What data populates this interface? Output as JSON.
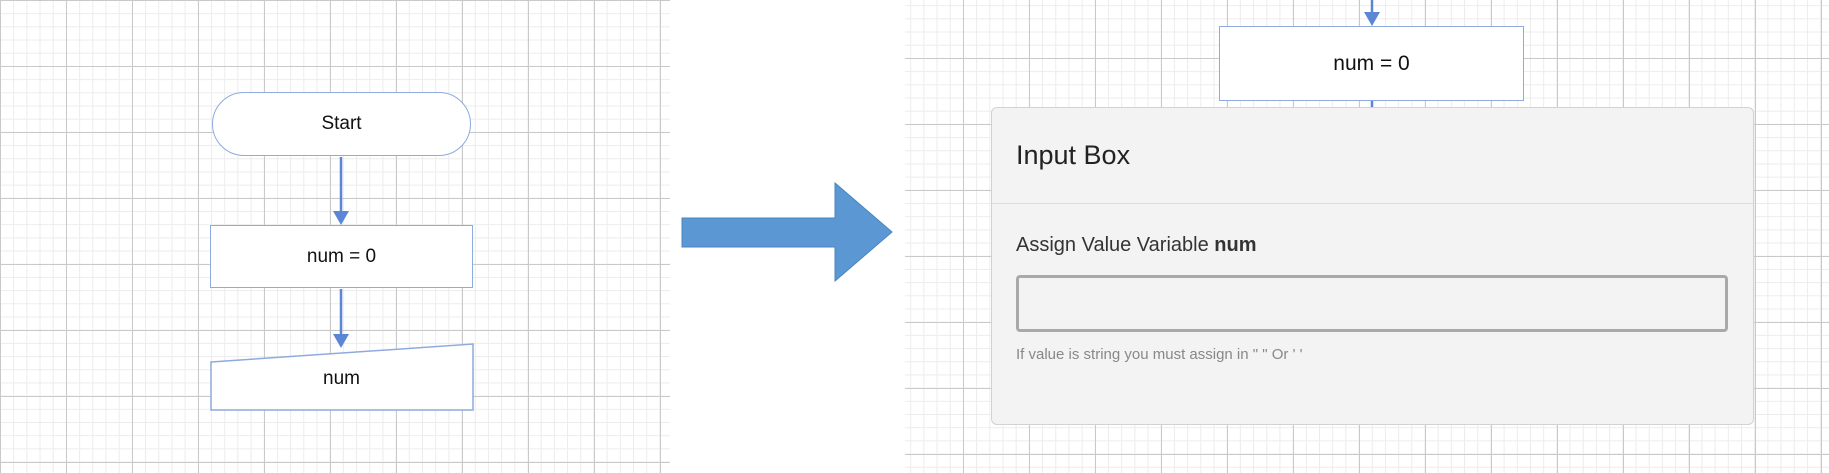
{
  "flowchart": {
    "start_label": "Start",
    "assign_label": "num = 0",
    "input_label": "num"
  },
  "zoomed": {
    "assign_label": "num = 0"
  },
  "dialog": {
    "title": "Input Box",
    "assign_prefix": "Assign Value Variable ",
    "variable_name": "num",
    "input_value": "",
    "help_text": "If value is string you must assign in \" \" Or ' '"
  },
  "colors": {
    "connector": "#5b86d6",
    "transition_arrow": "#5a97d3",
    "node_border": "#8eaadf"
  },
  "icons": {
    "transition": "right-arrow-icon"
  }
}
